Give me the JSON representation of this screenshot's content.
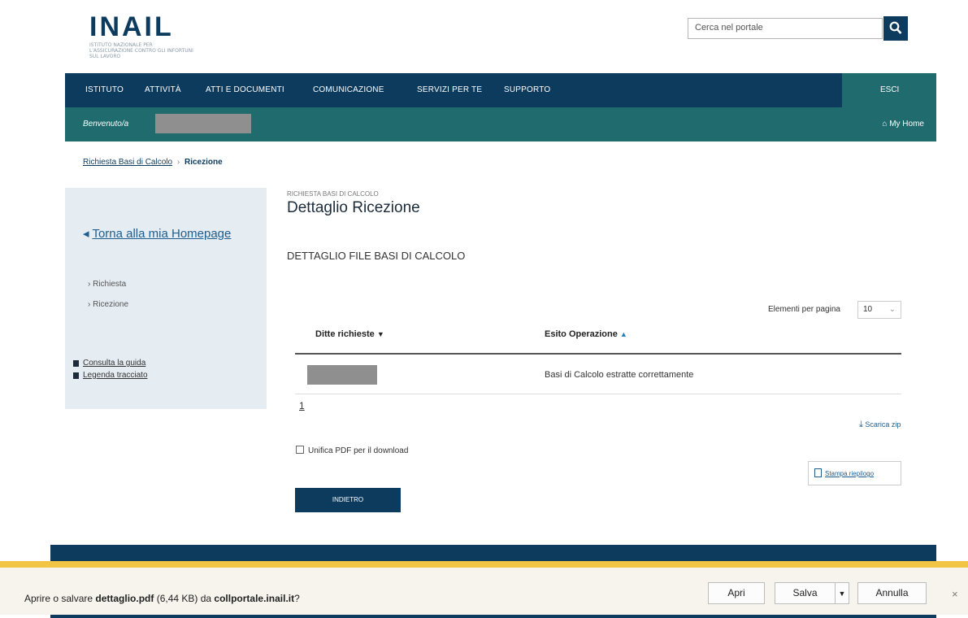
{
  "header": {
    "logo_text": "INAIL",
    "logo_subtitle": "ISTITUTO NAZIONALE PER L'ASSICURAZIONE CONTRO GLI INFORTUNI SUL LAVORO",
    "search_placeholder": "Cerca nel portale"
  },
  "nav": {
    "items": [
      "ISTITUTO",
      "ATTIVITÀ",
      "ATTI E DOCUMENTI",
      "COMUNICAZIONE",
      "SERVIZI PER TE",
      "SUPPORTO"
    ],
    "logout": "ESCI"
  },
  "welcome": {
    "label": "Benvenuto/a",
    "my_home": "My Home"
  },
  "breadcrumb": {
    "link": "Richiesta Basi di Calcolo",
    "separator": "›",
    "current": "Ricezione"
  },
  "sidebar": {
    "back_link": "Torna alla mia Homepage",
    "items": [
      "Richiesta",
      "Ricezione"
    ],
    "links": [
      "Consulta la guida",
      "Legenda tracciato"
    ]
  },
  "main": {
    "kicker": "RICHIESTA BASI DI CALCOLO",
    "title": "Dettaglio Ricezione",
    "subtitle": "DETTAGLIO FILE BASI DI CALCOLO",
    "per_page_label": "Elementi per pagina",
    "per_page_value": "10",
    "columns": [
      "Ditte richieste",
      "Esito Operazione"
    ],
    "rows": [
      {
        "esito": "Basi di Calcolo estratte correttamente"
      }
    ],
    "page_number": "1",
    "download_zip": "Scarica zip",
    "merge_pdf": "Unifica PDF per il download",
    "print_report": "Stampa riepilogo",
    "back_button": "INDIETRO"
  },
  "download_bar": {
    "prefix": "Aprire o salvare ",
    "filename": "dettaglio.pdf",
    "middle": " (6,44 KB) da ",
    "host": "collportale.inail.it",
    "suffix": "?",
    "open": "Apri",
    "save": "Salva",
    "cancel": "Annulla",
    "close": "×"
  },
  "colors": {
    "primary": "#0c3b5e",
    "secondary": "#1f6b6e",
    "download_accent": "#f2c443"
  }
}
